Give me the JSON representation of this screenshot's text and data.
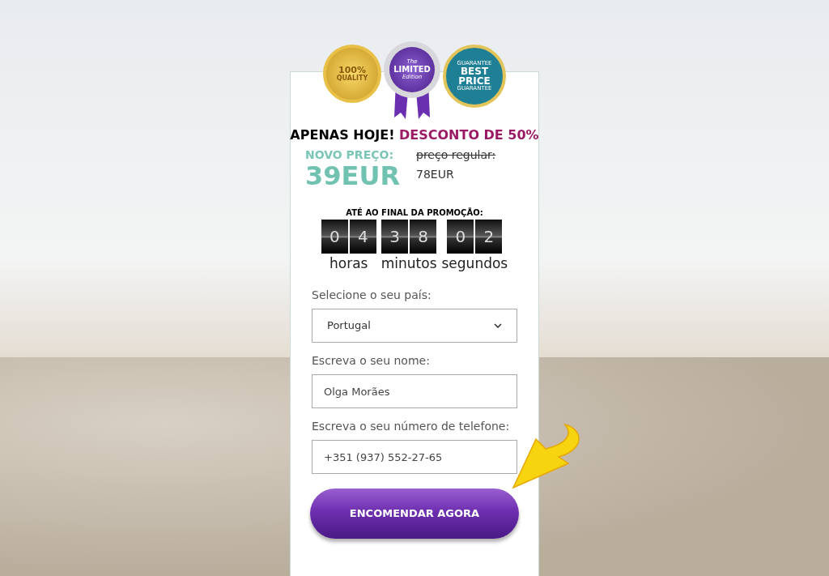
{
  "badges": [
    {
      "kind": "quality",
      "lines": [
        "100%",
        "QUALITY"
      ]
    },
    {
      "kind": "limited",
      "lines": [
        "The",
        "LIMITED",
        "Edition"
      ]
    },
    {
      "kind": "price",
      "lines": [
        "GUARANTEE",
        "BEST",
        "PRICE",
        "GUARANTEE"
      ]
    }
  ],
  "headline": {
    "lead": "APENAS HOJE!",
    "accent": "DESCONTO DE 50%"
  },
  "new_price": {
    "label": "NOVO PREÇO:",
    "value": "39EUR"
  },
  "old_price": {
    "label": "preço regular:",
    "value": "78EUR"
  },
  "countdown": {
    "title": "ATÉ AO FINAL DA PROMOÇÃO:",
    "groups": [
      {
        "digits": [
          "0",
          "4"
        ],
        "label": "horas"
      },
      {
        "digits": [
          "3",
          "8"
        ],
        "label": "minutos"
      },
      {
        "digits": [
          "0",
          "2"
        ],
        "label": "segundos"
      }
    ]
  },
  "form": {
    "fields": [
      {
        "kind": "select",
        "label": "Selecione o seu país:",
        "value": "Portugal"
      },
      {
        "kind": "text",
        "label": "Escreva o seu nome:",
        "value": "Olga Morães"
      },
      {
        "kind": "text",
        "label": "Escreva o seu número de telefone:",
        "value": "+351 (937) 552-27-65"
      }
    ],
    "submit": "ENCOMENDAR AGORA"
  }
}
